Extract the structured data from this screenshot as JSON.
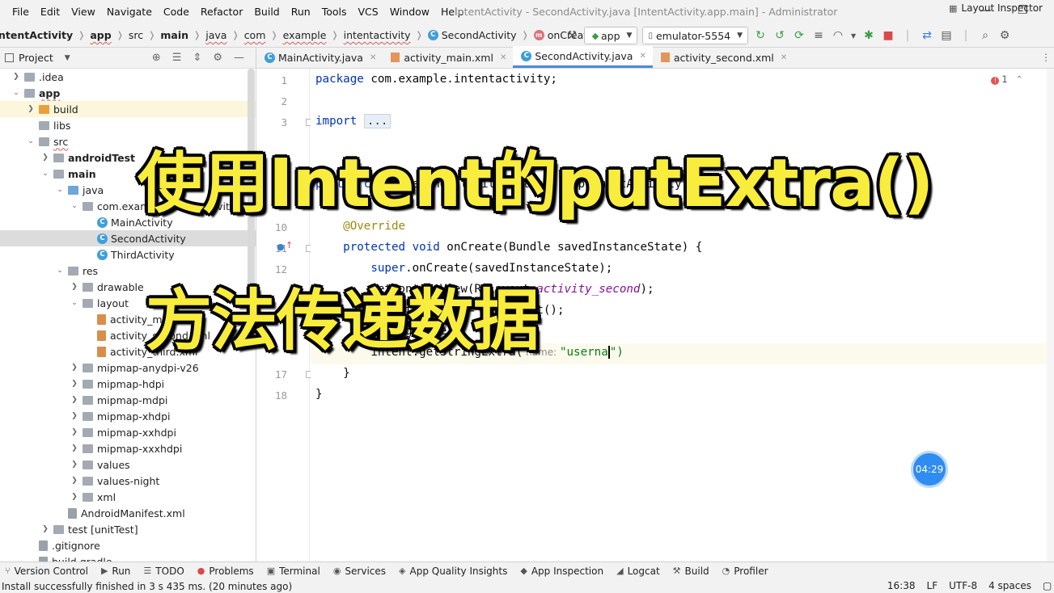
{
  "menu": [
    "File",
    "Edit",
    "View",
    "Navigate",
    "Code",
    "Refactor",
    "Build",
    "Run",
    "Tools",
    "VCS",
    "Window",
    "Help"
  ],
  "window_title": "IntentActivity - SecondActivity.java [IntentActivity.app.main] - Administrator",
  "breadcrumb": {
    "items": [
      "ntentActivity",
      "app",
      "src",
      "main",
      "java",
      "com",
      "example",
      "intentactivity"
    ],
    "class_name": "SecondActivity",
    "method_name": "onCreate",
    "class_icon": "C",
    "method_icon": "m"
  },
  "toolbar": {
    "config": "app",
    "device": "emulator-5554"
  },
  "project_panel": {
    "title": "Project",
    "rows": [
      {
        "label": ".idea",
        "indent": 1,
        "arrow": "right",
        "icon": "gray"
      },
      {
        "label": "app",
        "indent": 1,
        "arrow": "down",
        "icon": "gray",
        "bold": true
      },
      {
        "label": "build",
        "indent": 2,
        "arrow": "right",
        "icon": "orange",
        "hl": "yellow"
      },
      {
        "label": "libs",
        "indent": 2,
        "arrow": "none",
        "icon": "gray"
      },
      {
        "label": "src",
        "indent": 2,
        "arrow": "down",
        "icon": "gray"
      },
      {
        "label": "androidTest",
        "indent": 3,
        "arrow": "right",
        "icon": "gray",
        "bold": true
      },
      {
        "label": "main",
        "indent": 3,
        "arrow": "down",
        "icon": "gray",
        "bold": true
      },
      {
        "label": "java",
        "indent": 4,
        "arrow": "down",
        "icon": "blue"
      },
      {
        "label": "com.example.intentactivity",
        "indent": 5,
        "arrow": "down",
        "icon": "gray"
      },
      {
        "label": "MainActivity",
        "indent": 6,
        "arrow": "none",
        "icon": "class"
      },
      {
        "label": "SecondActivity",
        "indent": 6,
        "arrow": "none",
        "icon": "class",
        "hl": "sel"
      },
      {
        "label": "ThirdActivity",
        "indent": 6,
        "arrow": "none",
        "icon": "class"
      },
      {
        "label": "res",
        "indent": 4,
        "arrow": "down",
        "icon": "gray"
      },
      {
        "label": "drawable",
        "indent": 5,
        "arrow": "right",
        "icon": "gray"
      },
      {
        "label": "layout",
        "indent": 5,
        "arrow": "down",
        "icon": "gray"
      },
      {
        "label": "activity_main.xml",
        "indent": 6,
        "arrow": "none",
        "icon": "doc"
      },
      {
        "label": "activity_second.xml",
        "indent": 6,
        "arrow": "none",
        "icon": "doc"
      },
      {
        "label": "activity_third.xml",
        "indent": 6,
        "arrow": "none",
        "icon": "doc"
      },
      {
        "label": "mipmap-anydpi-v26",
        "indent": 5,
        "arrow": "right",
        "icon": "gray"
      },
      {
        "label": "mipmap-hdpi",
        "indent": 5,
        "arrow": "right",
        "icon": "gray"
      },
      {
        "label": "mipmap-mdpi",
        "indent": 5,
        "arrow": "right",
        "icon": "gray"
      },
      {
        "label": "mipmap-xhdpi",
        "indent": 5,
        "arrow": "right",
        "icon": "gray"
      },
      {
        "label": "mipmap-xxhdpi",
        "indent": 5,
        "arrow": "right",
        "icon": "gray"
      },
      {
        "label": "mipmap-xxxhdpi",
        "indent": 5,
        "arrow": "right",
        "icon": "gray"
      },
      {
        "label": "values",
        "indent": 5,
        "arrow": "right",
        "icon": "gray"
      },
      {
        "label": "values-night",
        "indent": 5,
        "arrow": "right",
        "icon": "gray"
      },
      {
        "label": "xml",
        "indent": 5,
        "arrow": "right",
        "icon": "gray"
      },
      {
        "label": "AndroidManifest.xml",
        "indent": 4,
        "arrow": "none",
        "icon": "gdoc"
      },
      {
        "label": "test [unitTest]",
        "indent": 3,
        "arrow": "right",
        "icon": "gray"
      },
      {
        "label": ".gitignore",
        "indent": 2,
        "arrow": "none",
        "icon": "gdoc"
      },
      {
        "label": "build.gradle",
        "indent": 2,
        "arrow": "none",
        "icon": "gdoc"
      }
    ]
  },
  "tabs": [
    {
      "label": "MainActivity.java",
      "kind": "class"
    },
    {
      "label": "activity_main.xml",
      "kind": "xml"
    },
    {
      "label": "SecondActivity.java",
      "kind": "class",
      "active": true
    },
    {
      "label": "activity_second.xml",
      "kind": "xml"
    }
  ],
  "editor": {
    "line_numbers": [
      "1",
      "2",
      "3",
      "",
      "",
      "",
      "",
      "",
      "10",
      "11",
      "12",
      "",
      "",
      "",
      "",
      "",
      "17",
      "18"
    ],
    "lines": {
      "l1_kw": "package",
      "l1_rest": " com.example.intentactivity;",
      "l3_kw": "import",
      "l3_fold": "...",
      "l10": "@Override",
      "l11_kw": "protected void",
      "l11_rest": " onCreate(Bundle savedInstanceState) {",
      "l12_kw": "super",
      "l12_rest": ".onCreate(savedInstanceState);",
      "l13_a": "setContentView(R.layout.",
      "l13_b": "activity_second",
      "l13_c": ");",
      "l14": "Intent intent = getIntent();",
      "l15": "String name = ",
      "l16_a": "intent.getStringExtra(",
      "l16_hint": " name: ",
      "l16_str": "\"userna",
      "l16_close": "\")",
      "l17": "}",
      "l18": "}",
      "l8_kw": "public class",
      "l8_rest": " SecondActivity extends AppCompatActivity {"
    },
    "error_count": "1"
  },
  "overlay": {
    "line1": "使用Intent的putExtra()",
    "line2": "方法传递数据"
  },
  "timer": "04:29",
  "tool_windows": [
    {
      "label": "Version Control",
      "icon": "⑂"
    },
    {
      "label": "Run",
      "icon": "▶"
    },
    {
      "label": "TODO",
      "icon": "☰"
    },
    {
      "label": "Problems",
      "icon": "●"
    },
    {
      "label": "Terminal",
      "icon": "▣"
    },
    {
      "label": "Services",
      "icon": "◉"
    },
    {
      "label": "App Quality Insights",
      "icon": "◈"
    },
    {
      "label": "App Inspection",
      "icon": "◆"
    },
    {
      "label": "Logcat",
      "icon": "◢"
    },
    {
      "label": "Build",
      "icon": "⚒"
    },
    {
      "label": "Profiler",
      "icon": "◔"
    }
  ],
  "layout_inspector": "Layout Inspector",
  "status": {
    "message": "Install successfully finished in 3 s 435 ms. (20 minutes ago)",
    "position": "16:38",
    "line_sep": "LF",
    "encoding": "UTF-8",
    "indent": "4 spaces"
  },
  "colors": {
    "accent": "#4d88e3",
    "overlay_text": "#f8ec3c",
    "keyword": "#0033b3",
    "annotation": "#9e880d",
    "string": "#067d17"
  }
}
